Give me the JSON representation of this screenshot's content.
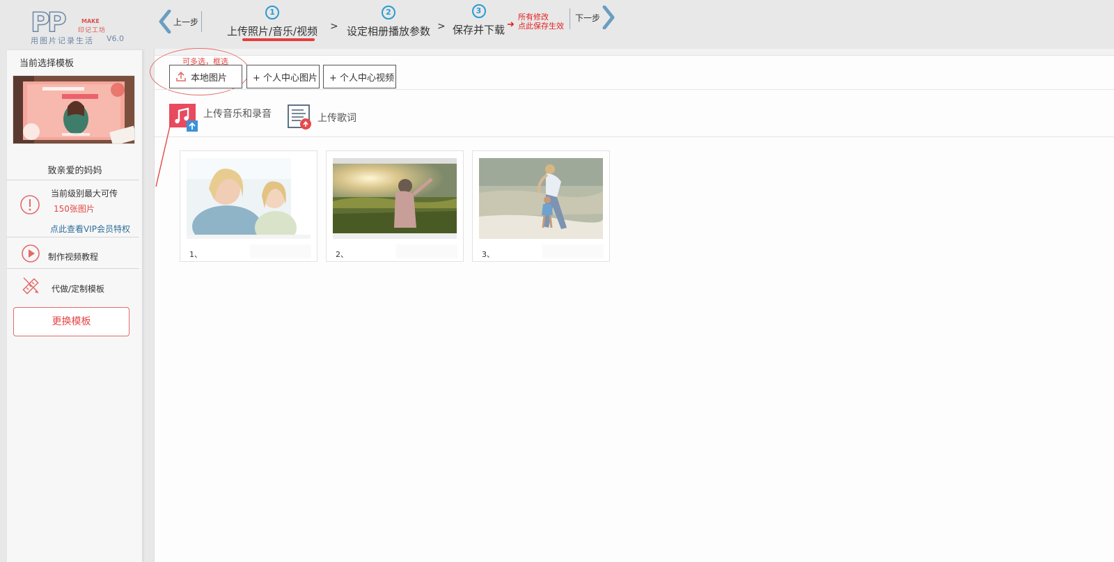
{
  "header": {
    "logo": {
      "pp": "PP",
      "make": "MAKE",
      "brand": "印记工坊",
      "slogan": "用图片记录生活",
      "version": "V6.0"
    },
    "prev_label": "上一步",
    "next_label": "下一步",
    "steps": [
      {
        "num": "1",
        "label": "上传照片/音乐/视频"
      },
      {
        "num": "2",
        "label": "设定相册播放参数"
      },
      {
        "num": "3",
        "label": "保存并下载"
      }
    ],
    "step_separator": ">",
    "save_note_line1": "所有修改",
    "save_note_line2": "点此保存生效",
    "active_step": 1
  },
  "sidebar": {
    "title": "当前选择模板",
    "template_name": "致亲爱的妈妈",
    "limit_line1": "当前级别最大可传",
    "limit_line2": "150张图片",
    "vip_link": "点此查看VIP会员特权",
    "tutorial_label": "制作视频教程",
    "custom_label": "代做/定制模板",
    "change_button": "更换模板"
  },
  "main": {
    "hint": "可多选，框选",
    "upload_buttons": [
      {
        "label": "本地图片",
        "icon": "upload-icon"
      },
      {
        "label": "+ 个人中心图片"
      },
      {
        "label": "+ 个人中心视频"
      }
    ],
    "media_buttons": [
      {
        "label": "上传音乐和录音",
        "icon": "music-upload-icon"
      },
      {
        "label": "上传歌词",
        "icon": "lyrics-upload-icon"
      }
    ],
    "photos": [
      {
        "caption": "1、"
      },
      {
        "caption": "2、"
      },
      {
        "caption": "3、"
      }
    ]
  },
  "colors": {
    "accent_red": "#e64646",
    "step_blue": "#2c9ad0",
    "nav_arrow": "#6a9ec0",
    "logo_blue": "#6c87a6"
  }
}
